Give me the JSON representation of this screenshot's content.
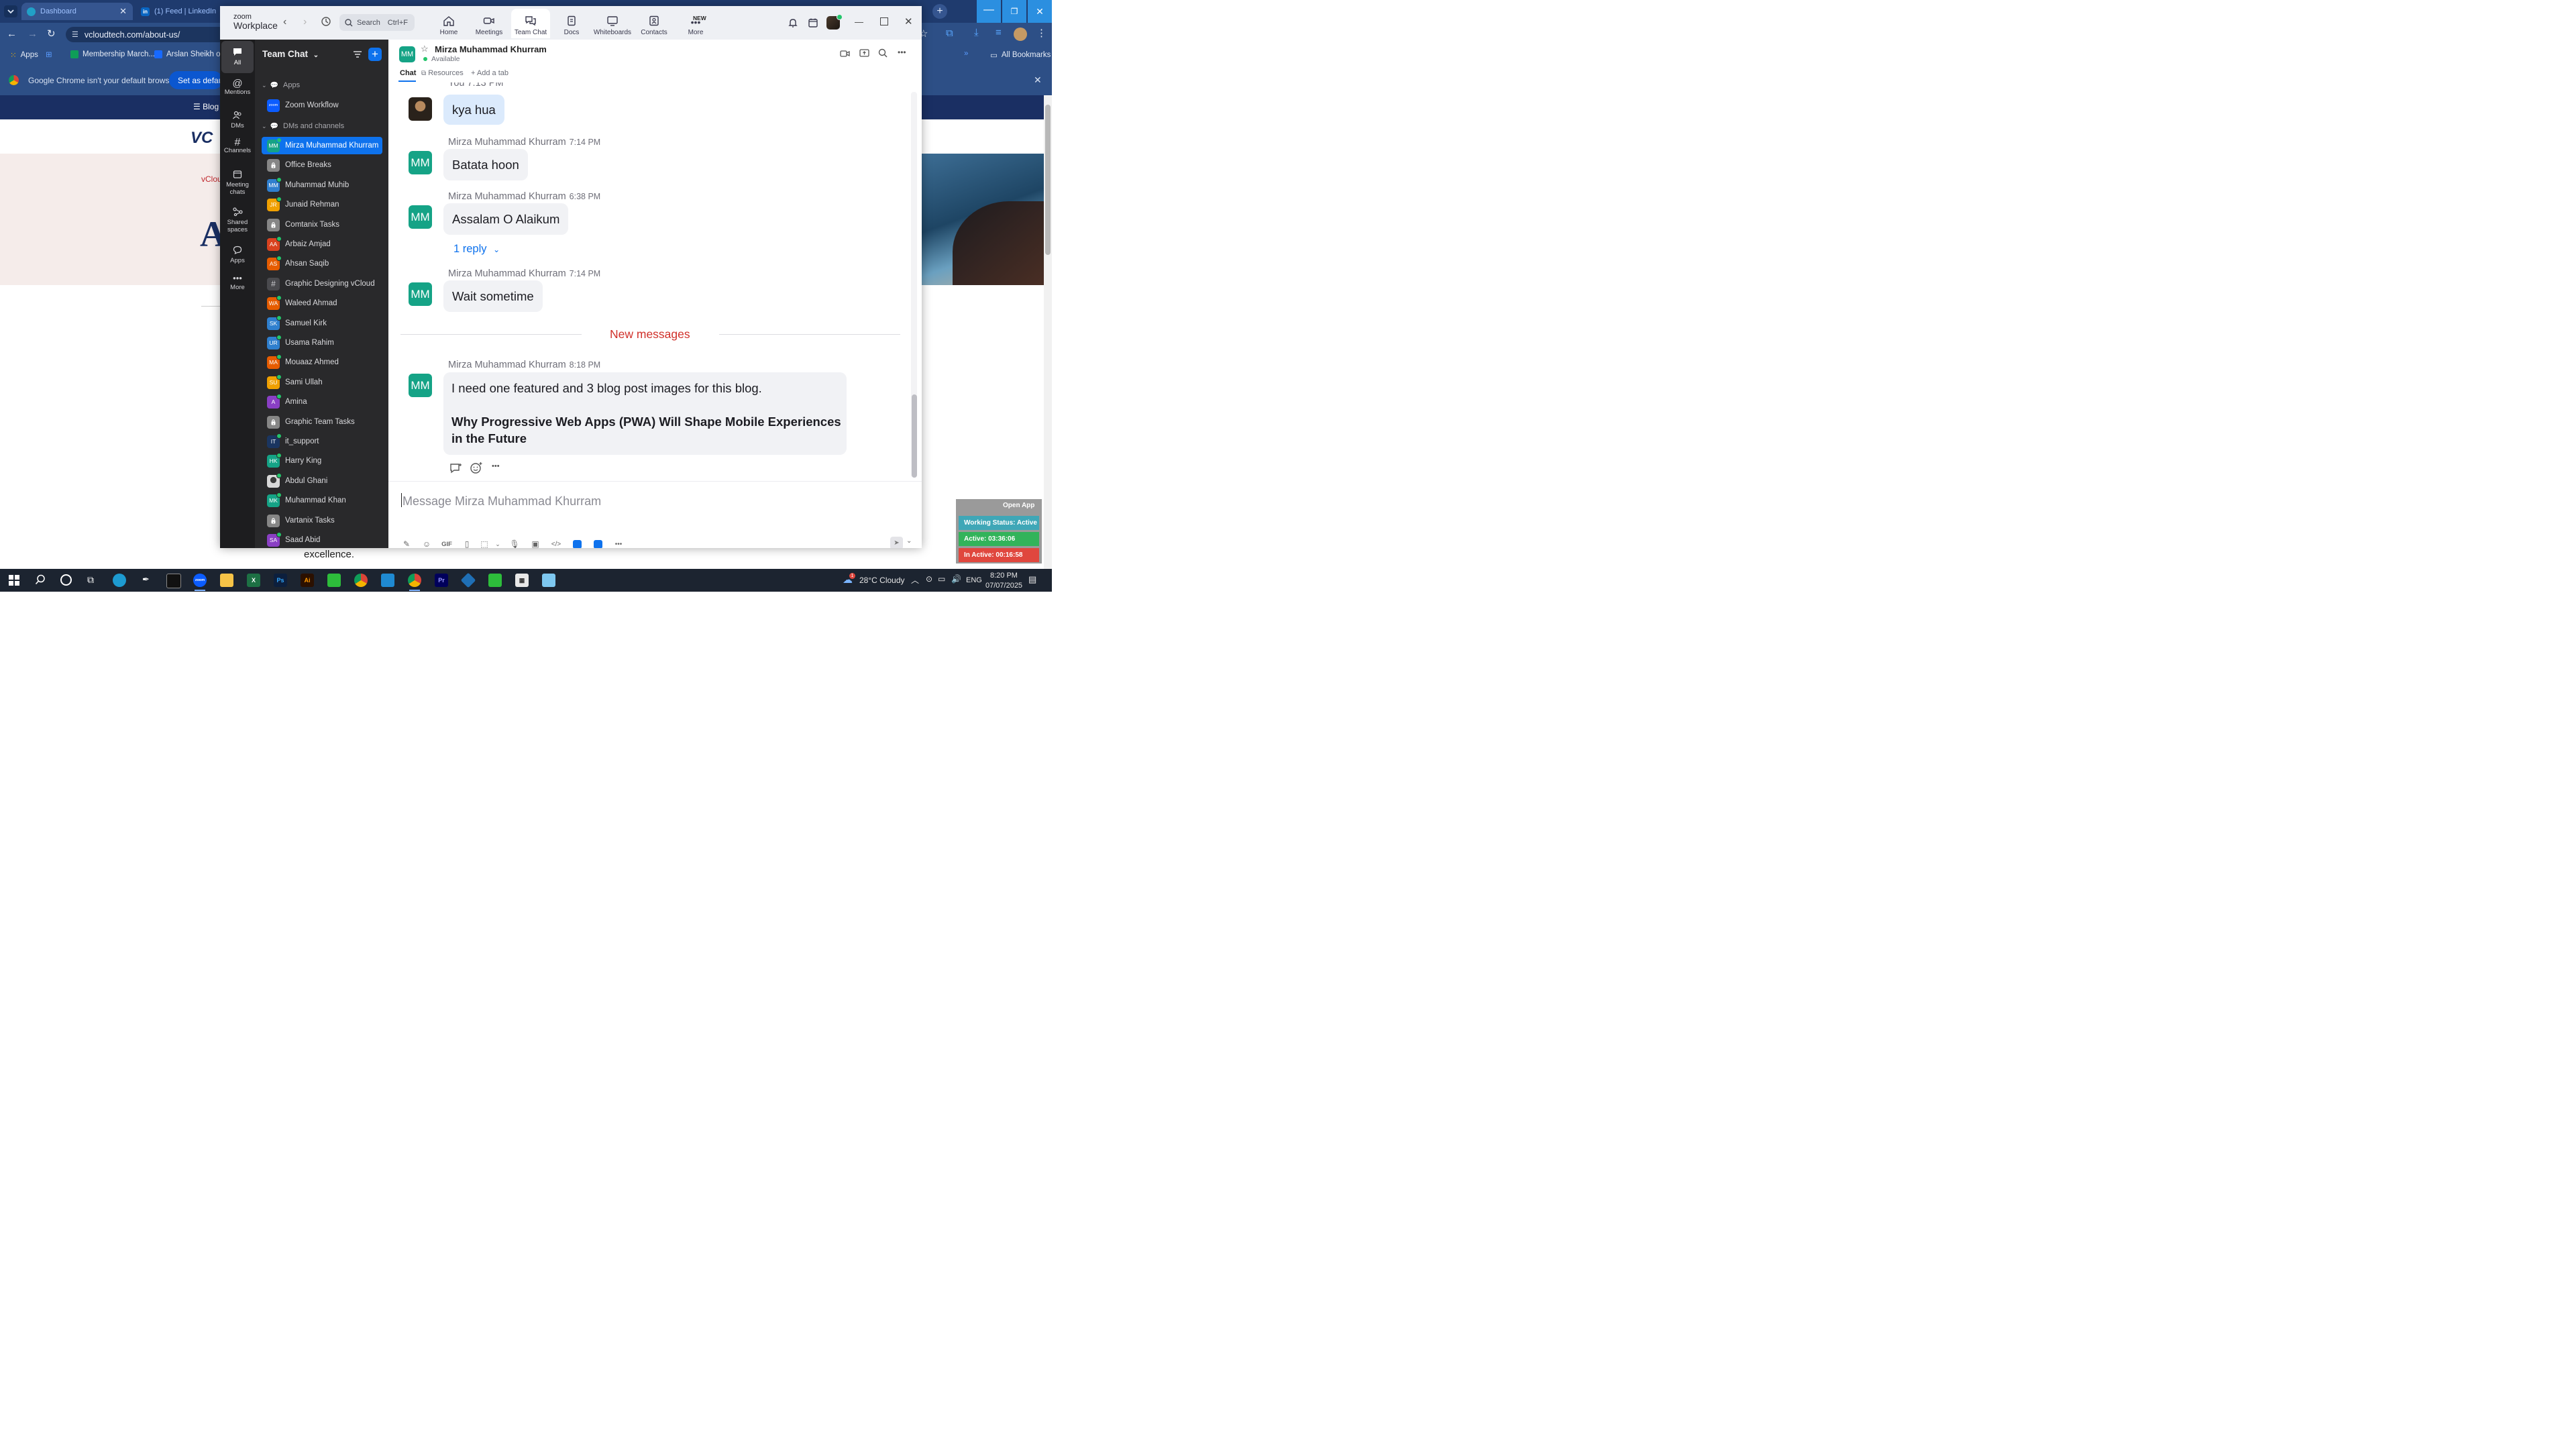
{
  "browser": {
    "tabs": [
      {
        "title": "Dashboard"
      },
      {
        "title": "(1) Feed | LinkedIn"
      }
    ],
    "url": "vcloudtech.com/about-us/",
    "bookmarks": {
      "apps": "Apps",
      "item1": "Membership March...",
      "item2": "Arslan Sheikh on B...",
      "all": "All Bookmarks"
    },
    "default_bar": {
      "message": "Google Chrome isn't your default browser",
      "button": "Set as default"
    }
  },
  "website": {
    "nav_blog": "Blog",
    "logo": "VC",
    "hero_small": "vClou",
    "hero_big": "A",
    "excellence": "excellence."
  },
  "zoom": {
    "brand_top": "zoom",
    "brand_bottom": "Workplace",
    "search": {
      "label": "Search",
      "shortcut": "Ctrl+F"
    },
    "tabs": [
      "Home",
      "Meetings",
      "Team Chat",
      "Docs",
      "Whiteboards",
      "Contacts",
      "More"
    ],
    "new_badge": "NEW",
    "rail": [
      "All",
      "Mentions",
      "DMs",
      "Channels",
      "Meeting chats",
      "Shared spaces",
      "Apps",
      "More"
    ],
    "sidebar": {
      "title": "Team Chat",
      "section_apps": "Apps",
      "app_item": "Zoom Workflow",
      "section_dms": "DMs and channels",
      "items": [
        {
          "name": "Mirza Muhammad Khurram",
          "initials": "MM",
          "color": "#15a386",
          "active": true
        },
        {
          "name": "Office Breaks",
          "initials": "",
          "color": "#4a4a4e",
          "kind": "lock"
        },
        {
          "name": "Muhammad Muhib",
          "initials": "MM",
          "color": "#2f7fce"
        },
        {
          "name": "Junaid Rehman",
          "initials": "JR",
          "color": "#f0a000"
        },
        {
          "name": "Comtanix Tasks",
          "initials": "",
          "color": "#4a4a4e",
          "kind": "lock"
        },
        {
          "name": "Arbaiz Amjad",
          "initials": "AA",
          "color": "#d9421f"
        },
        {
          "name": "Ahsan Saqib",
          "initials": "AS",
          "color": "#e65c00"
        },
        {
          "name": "Graphic Designing vCloud",
          "initials": "#",
          "color": "#4a4a4e",
          "kind": "hash"
        },
        {
          "name": "Waleed Ahmad",
          "initials": "WA",
          "color": "#e65c00"
        },
        {
          "name": "Samuel Kirk",
          "initials": "SK",
          "color": "#2f7fce"
        },
        {
          "name": "Usama Rahim",
          "initials": "UR",
          "color": "#2f7fce"
        },
        {
          "name": "Mouaaz Ahmed",
          "initials": "MA",
          "color": "#e65c00"
        },
        {
          "name": "Sami Ullah",
          "initials": "SU",
          "color": "#f0a000"
        },
        {
          "name": "Amina",
          "initials": "A",
          "color": "#8a3fc4"
        },
        {
          "name": "Graphic Team Tasks",
          "initials": "",
          "color": "#4a4a4e",
          "kind": "lock"
        },
        {
          "name": "it_support",
          "initials": "IT",
          "color": "#1a3560"
        },
        {
          "name": "Harry King",
          "initials": "HK",
          "color": "#15a386"
        },
        {
          "name": "Abdul Ghani",
          "initials": "",
          "color": "#d8d8d8",
          "kind": "photo"
        },
        {
          "name": "Muhammad Khan",
          "initials": "MK",
          "color": "#15a386"
        },
        {
          "name": "Vartanix Tasks",
          "initials": "",
          "color": "#4a4a4e",
          "kind": "lock"
        },
        {
          "name": "Saad Abid",
          "initials": "SA",
          "color": "#8a3fc4"
        }
      ]
    },
    "chat": {
      "contact": "Mirza Muhammad Khurram",
      "initials": "MM",
      "status": "Available",
      "tabs": [
        "Chat",
        "Resources",
        "Add a tab"
      ],
      "partial_meta": "You 7:13 PM",
      "messages": [
        {
          "sender": "",
          "time": "",
          "text": "kya hua",
          "self": true
        },
        {
          "sender": "Mirza Muhammad Khurram",
          "time": "7:14 PM",
          "text": "Batata hoon"
        },
        {
          "sender": "Mirza Muhammad Khurram",
          "time": "6:38 PM",
          "text": "Assalam O Alaikum",
          "reply": "1 reply"
        },
        {
          "sender": "Mirza Muhammad Khurram",
          "time": "7:14 PM",
          "text": "Wait sometime"
        }
      ],
      "divider": "New messages",
      "last": {
        "sender": "Mirza Muhammad Khurram",
        "time": "8:18 PM",
        "line1": "I need one featured and 3 blog post images for this blog.",
        "bold1": "Why Progressive Web Apps (PWA) Will Shape Mobile Experiences",
        "bold2": "in the Future"
      },
      "composer_placeholder": "Message Mirza Muhammad Khurram",
      "composer_gif": "GIF"
    }
  },
  "extension": {
    "open": "Open App",
    "status": "Working Status: Active",
    "active": "Active: 03:36:06",
    "inactive": "In Active: 00:16:58"
  },
  "taskbar": {
    "weather": "28°C  Cloudy",
    "lang": "ENG",
    "time": "8:20 PM",
    "date": "07/07/2025",
    "weather_badge": "1"
  }
}
